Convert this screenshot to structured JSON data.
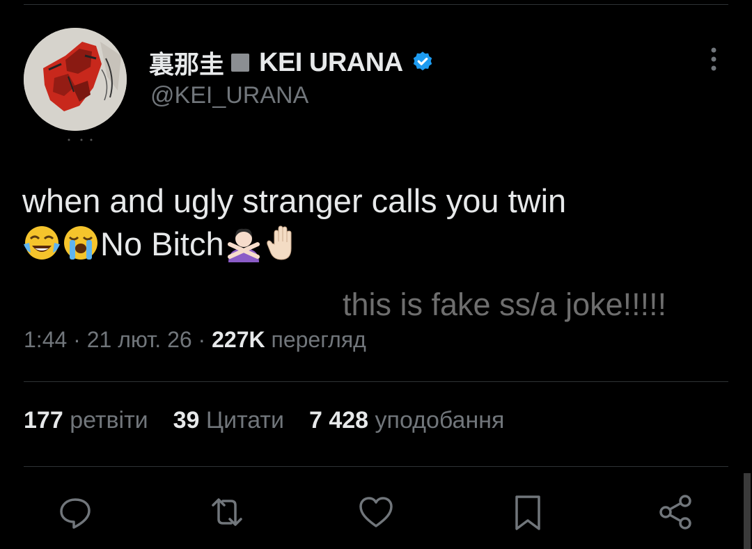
{
  "author": {
    "name_cjk": "裏那圭",
    "name_latin": "KEI URANA",
    "handle": "@KEI_URANA",
    "verified": true
  },
  "tweet": {
    "text_line1": "when and ugly stranger calls you twin",
    "text_line2": "No Bitch",
    "emojis": [
      "face-with-tears-of-joy",
      "loudly-crying-face",
      "person-gesturing-no",
      "raised-hand"
    ]
  },
  "overlay_text": "this is fake ss/a joke!!!!!",
  "meta": {
    "time": "1:44",
    "sep1": " · ",
    "date": "21 лют. 26",
    "sep2": " · ",
    "views_count": "227K",
    "views_label": "перегляд"
  },
  "stats": {
    "retweets_count": "177",
    "retweets_label": "ретвіти",
    "quotes_count": "39",
    "quotes_label": "Цитати",
    "likes_count": "7 428",
    "likes_label": "уподобання"
  },
  "actions": [
    "reply-icon",
    "retweet-icon",
    "like-icon",
    "bookmark-icon",
    "share-icon"
  ],
  "colors": {
    "background": "#000000",
    "primary_text": "#e7e9ea",
    "secondary_text": "#71767b",
    "verified_blue": "#1d9bf0",
    "divider": "#2f3336"
  }
}
